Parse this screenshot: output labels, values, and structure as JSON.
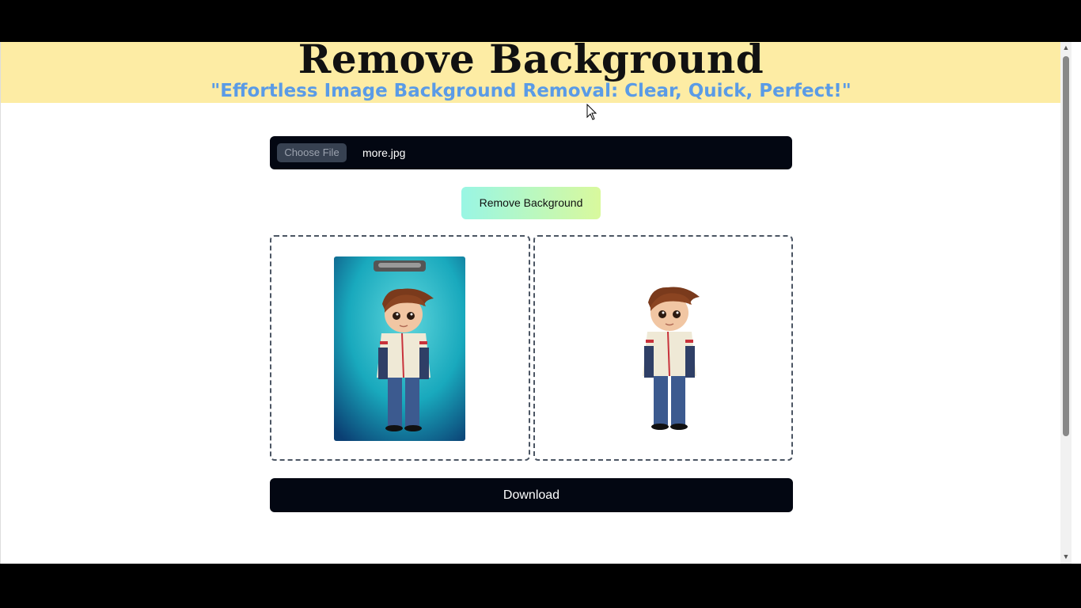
{
  "header": {
    "title": "Remove Background",
    "subtitle": "\"Effortless Image Background Removal: Clear, Quick, Perfect!\""
  },
  "file_input": {
    "button_label": "Choose File",
    "file_name": "more.jpg"
  },
  "actions": {
    "remove_label": "Remove Background",
    "download_label": "Download"
  },
  "colors": {
    "header_bg": "#fdeca4",
    "subtitle": "#5a9be6",
    "dark": "#030712"
  },
  "images": {
    "original": "cartoon-boy-on-clipboard-teal-background",
    "result": "cartoon-boy-background-removed"
  }
}
